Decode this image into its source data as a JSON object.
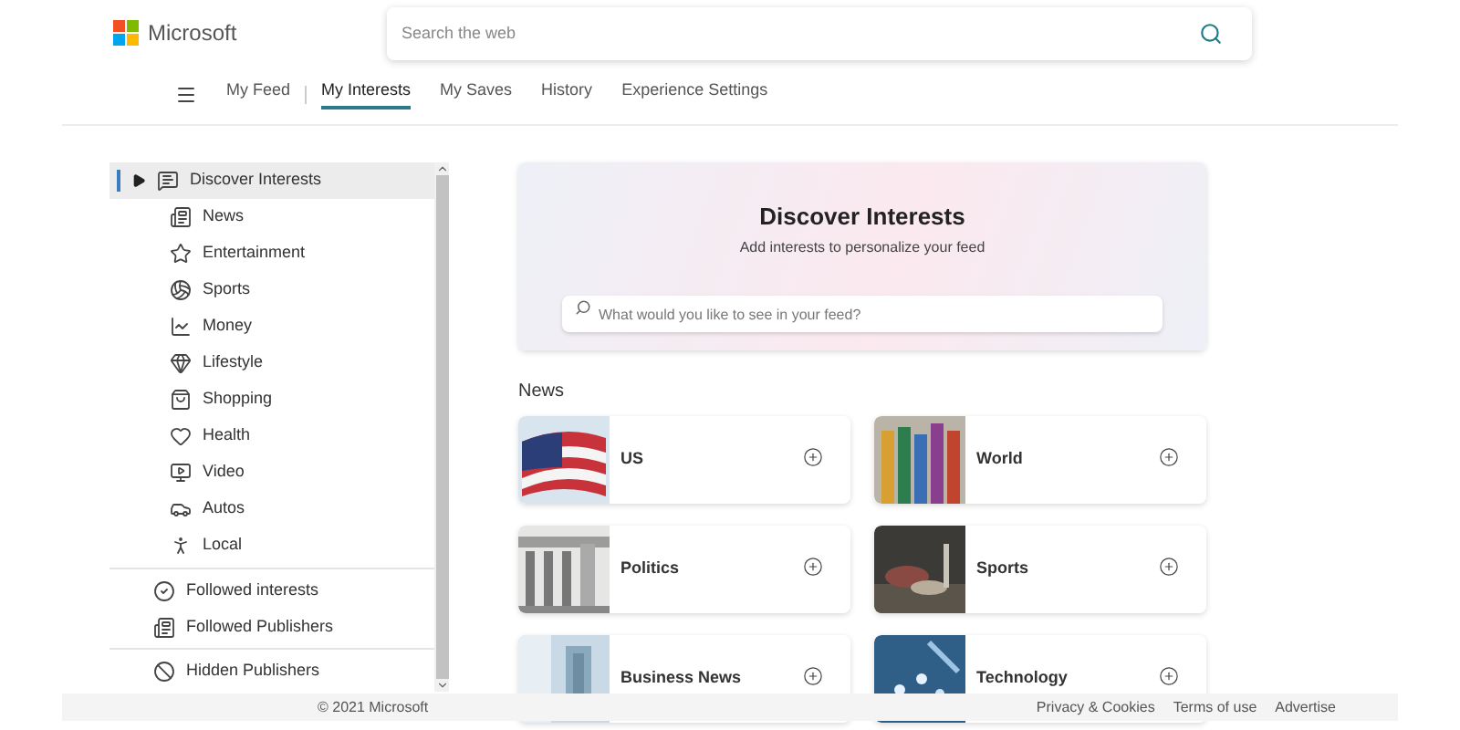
{
  "header": {
    "logo": "Microsoft",
    "search": {
      "placeholder": "Search the web"
    }
  },
  "nav": [
    {
      "label": "My Feed",
      "selected": false
    },
    {
      "label": "My Interests",
      "selected": true
    },
    {
      "label": "My Saves",
      "selected": false
    },
    {
      "label": "History",
      "selected": false
    },
    {
      "label": "Experience Settings",
      "selected": false
    }
  ],
  "sidebar": {
    "groups": [
      [
        {
          "label": "Discover Interests",
          "kind": "discover",
          "selected": true,
          "children": [
            {
              "label": "News",
              "kind": "news",
              "selected": false
            },
            {
              "label": "Entertainment",
              "kind": "star",
              "selected": false
            },
            {
              "label": "Sports",
              "kind": "ball",
              "selected": false
            },
            {
              "label": "Money",
              "kind": "chart",
              "selected": false
            },
            {
              "label": "Lifestyle",
              "kind": "gem",
              "selected": false
            },
            {
              "label": "Shopping",
              "kind": "bag",
              "selected": false
            },
            {
              "label": "Health",
              "kind": "heart",
              "selected": false
            },
            {
              "label": "Video",
              "kind": "video",
              "selected": false
            },
            {
              "label": "Autos",
              "kind": "car",
              "selected": false
            },
            {
              "label": "Local",
              "kind": "person",
              "selected": false
            }
          ]
        }
      ],
      [
        {
          "label": "Followed interests",
          "kind": "check",
          "selected": false
        },
        {
          "label": "Followed Publishers",
          "kind": "news",
          "selected": false
        }
      ],
      [
        {
          "label": "Hidden Publishers",
          "kind": "ban",
          "selected": false
        }
      ]
    ]
  },
  "hero": {
    "title": "Discover Interests",
    "subtitle": "Add interests to personalize your feed",
    "search": {
      "placeholder": "What would you like to see in your feed?"
    }
  },
  "section": {
    "title": "News",
    "cards": [
      {
        "label": "US"
      },
      {
        "label": "World"
      },
      {
        "label": "Politics"
      },
      {
        "label": "Sports"
      },
      {
        "label": "Business News"
      },
      {
        "label": "Technology"
      }
    ]
  },
  "footer": {
    "copyright": "© 2021 Microsoft",
    "links": [
      "Privacy & Cookies",
      "Terms of use",
      "Advertise"
    ]
  }
}
